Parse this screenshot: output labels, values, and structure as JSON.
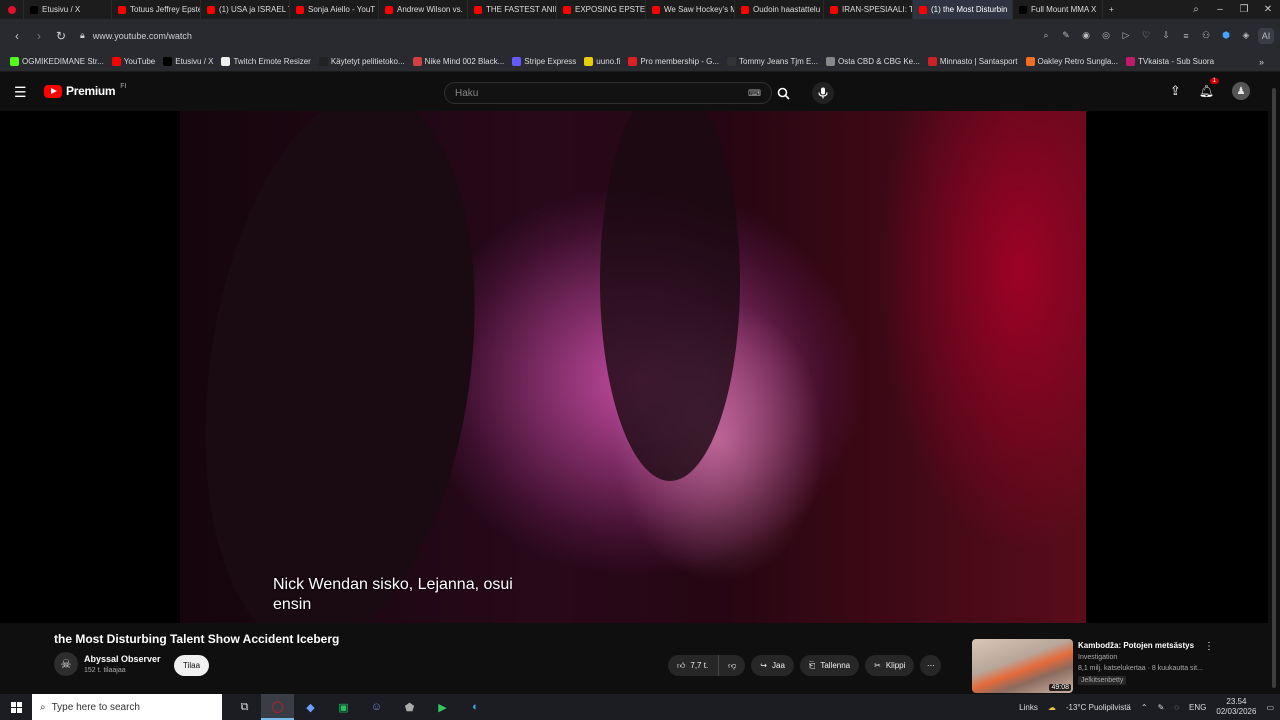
{
  "browser": {
    "tabs": [
      {
        "label": "Etusivu / X",
        "color": "#000000"
      },
      {
        "label": "Totuus Jeffrey Epste",
        "color": "#ff0000"
      },
      {
        "label": "(1) USA ja ISRAEL T",
        "color": "#ff0000"
      },
      {
        "label": "Sonja Aiello - YouT",
        "color": "#ff0000"
      },
      {
        "label": "Andrew Wilson vs.",
        "color": "#ff0000"
      },
      {
        "label": "THE FASTEST ANIM",
        "color": "#ff0000"
      },
      {
        "label": "EXPOSING EPSTEIN",
        "color": "#ff0000"
      },
      {
        "label": "We Saw Hockey's M",
        "color": "#ff0000"
      },
      {
        "label": "Oudoin haastattelu",
        "color": "#ff0000"
      },
      {
        "label": "IRAN-SPESIAALI: Tr",
        "color": "#ff0000"
      },
      {
        "label": "(1) the Most Disturbin",
        "color": "#ff0000",
        "active": true
      },
      {
        "label": "Full Mount MMA X",
        "color": "#000000"
      }
    ],
    "new_tab": "+",
    "url": "www.youtube.com/watch",
    "ai_label": "AI",
    "bookmarks": [
      {
        "label": "OGMIKEDIMANE Str...",
        "color": "#53fc18"
      },
      {
        "label": "YouTube",
        "color": "#ff0000"
      },
      {
        "label": "Etusivu / X",
        "color": "#000000"
      },
      {
        "label": "Twitch Emote Resizer",
        "color": "#eeeeee"
      },
      {
        "label": "Käytetyt pelitietoko...",
        "color": "#222222"
      },
      {
        "label": "Nike Mind 002 Black...",
        "color": "#d04040"
      },
      {
        "label": "Stripe Express",
        "color": "#635bff"
      },
      {
        "label": "uuno.fi",
        "color": "#e8d000"
      },
      {
        "label": "Pro membership - G...",
        "color": "#e02020"
      },
      {
        "label": "Tommy Jeans Tjm E...",
        "color": "#333333"
      },
      {
        "label": "Osta CBD & CBG Ke...",
        "color": "#888888"
      },
      {
        "label": "Minnasto | Santasport",
        "color": "#cc2222"
      },
      {
        "label": "Oakley Retro Sunglа...",
        "color": "#f07020"
      },
      {
        "label": "TVkaista - Sub Suora",
        "color": "#c01a6a"
      }
    ]
  },
  "youtube": {
    "logo_text": "Premium",
    "logo_superscript": "FI",
    "search_placeholder": "Haku",
    "notification_count": "1",
    "subtitle_line1": "Nick Wendan sisko, Lejanna, osui",
    "subtitle_line2": "ensin",
    "video_title": "the Most Disturbing Talent Show Accident Iceberg",
    "channel_name": "Abyssal Observer",
    "channel_subs": "152 t. tilaajaa",
    "subscribe_label": "Tilaa",
    "like_count": "7,7 t.",
    "share_label": "Jaa",
    "save_label": "Tallenna",
    "clip_label": "Klippi",
    "recommendation": {
      "title": "Kambodža: Potojen metsästys",
      "channel": "Investigation",
      "meta": "8,1 milj. katselukertaa · 8 kuukautta sit...",
      "badge": "Jelkitsenbetty",
      "duration": "49:08"
    }
  },
  "taskbar": {
    "search_placeholder": "Type here to search",
    "links_label": "Links",
    "weather": "-13°C  Puolipilvistä",
    "language": "ENG",
    "time": "23.54",
    "date": "02/03/2026"
  }
}
